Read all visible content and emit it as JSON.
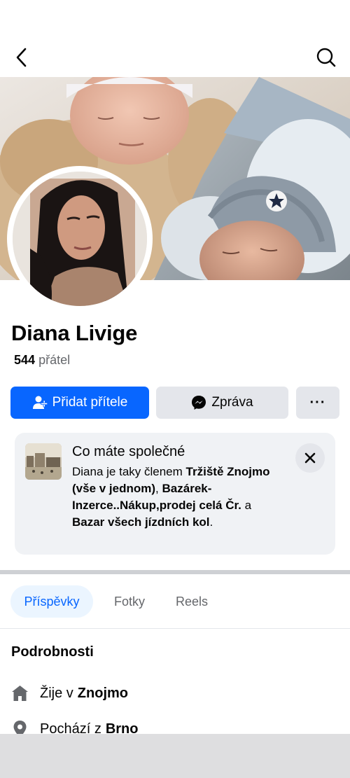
{
  "header": {
    "back_icon": "chevron-left-icon",
    "search_icon": "search-icon"
  },
  "profile": {
    "name": "Diana Livige",
    "friends_count": "544",
    "friends_label": "přátel"
  },
  "actions": {
    "add_friend_label": "Přidat přítele",
    "add_friend_icon": "add-person-icon",
    "message_label": "Zpráva",
    "message_icon": "messenger-icon",
    "more_label": "···"
  },
  "in_common": {
    "title": "Co máte společné",
    "intro": "Diana je taky členem",
    "group1": "Tržiště Znojmo (vše v jednom)",
    "sep1": ",",
    "group2": "Bazárek-Inzerce..Nákup,prodej celá Čr.",
    "sep2": "a",
    "group3": "Bazar všech jízdních kol",
    "end": ".",
    "close_icon": "close-icon"
  },
  "tabs": [
    {
      "label": "Příspěvky",
      "active": true
    },
    {
      "label": "Fotky",
      "active": false
    },
    {
      "label": "Reels",
      "active": false
    }
  ],
  "details": {
    "title": "Podrobnosti",
    "lives_prefix": "Žije v",
    "lives_city": "Znojmo",
    "from_prefix": "Pochází z",
    "from_city": "Brno"
  },
  "colors": {
    "primary": "#0866ff",
    "secondary_button": "#e4e6eb",
    "card_bg": "#f0f2f5",
    "active_tab_bg": "#ebf5ff"
  }
}
